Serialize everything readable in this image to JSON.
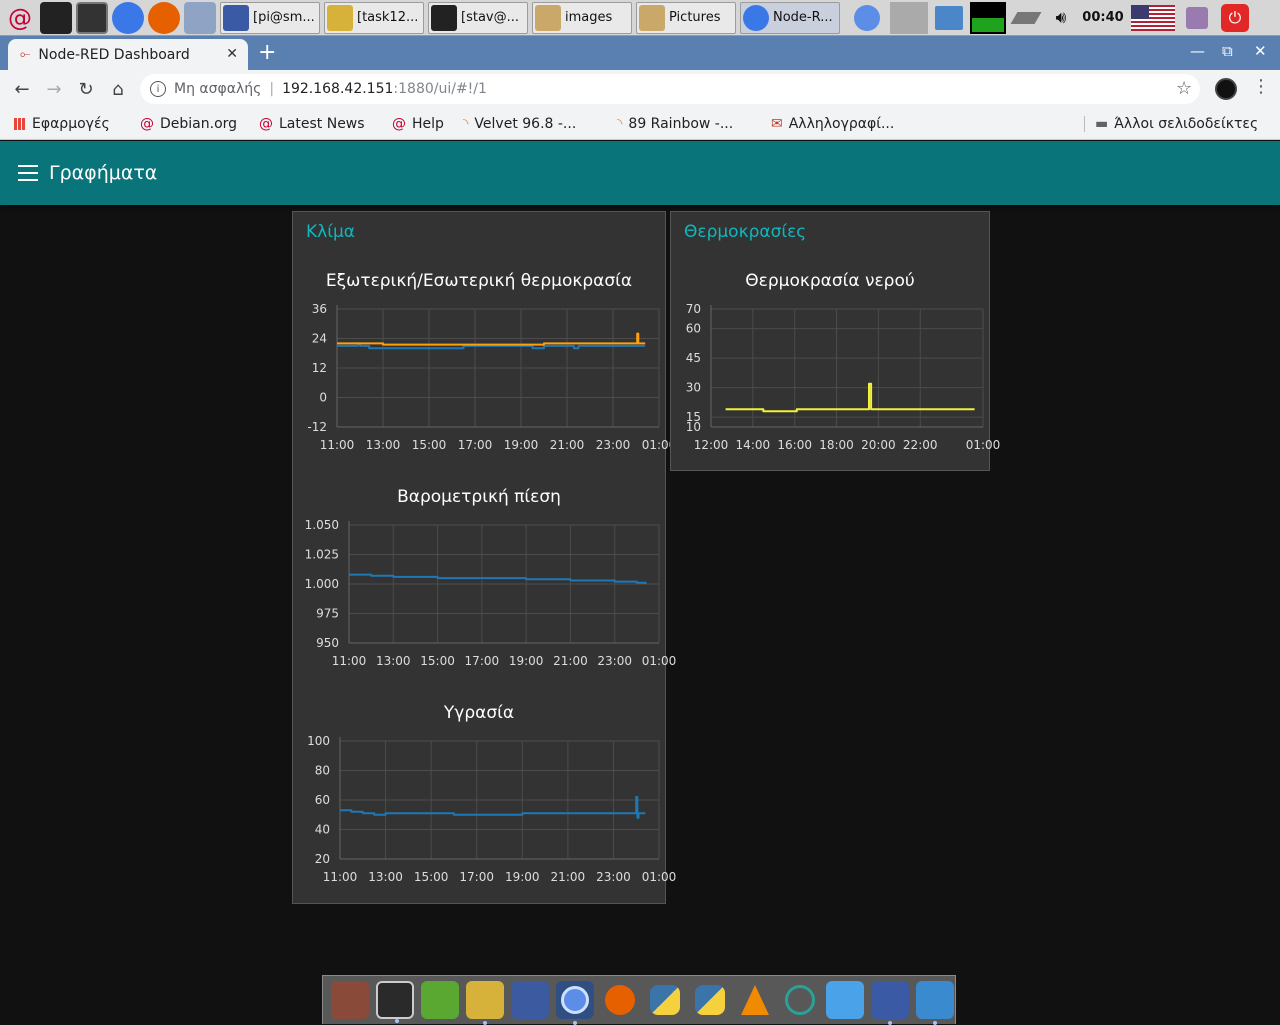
{
  "taskbar": {
    "windows": [
      {
        "label": "[pi@sm...",
        "color": "#3b5aa5"
      },
      {
        "label": "[task12...",
        "color": "#d6b23a"
      },
      {
        "label": "[stav@...",
        "color": "#222222"
      },
      {
        "label": "images",
        "color": "#c9a86a"
      },
      {
        "label": "Pictures",
        "color": "#c9a86a"
      },
      {
        "label": "Node-R...",
        "color": "#3b78e7"
      }
    ],
    "clock": "00:40"
  },
  "browser": {
    "tab_title": "Node-RED Dashboard",
    "new_tab": "+",
    "security_label": "Μη ασφαλής",
    "url_host": "192.168.42.151",
    "url_path": ":1880/ui/#!/1",
    "bookmarks": [
      {
        "label": "Εφαρμογές",
        "icon": "apps-grid-icon"
      },
      {
        "label": "Debian.org",
        "icon": "debian-icon"
      },
      {
        "label": "Latest News",
        "icon": "debian-icon"
      },
      {
        "label": "Help",
        "icon": "debian-icon"
      },
      {
        "label": "Velvet 96.8 -...",
        "icon": "rss-icon"
      },
      {
        "label": "89 Rainbow -...",
        "icon": "rss-icon"
      },
      {
        "label": "Αλληλογραφί...",
        "icon": "mail-icon"
      }
    ],
    "other_bookmarks": "Άλλοι σελιδοδείκτες"
  },
  "dashboard": {
    "page_title": "Γραφήματα",
    "colors": {
      "toolbar": "#097479",
      "group_title": "#0eb8c0",
      "series_blue": "#1f77b4",
      "series_orange": "#ff9f0a",
      "series_yellow": "#f2f23a"
    },
    "groups": [
      {
        "title": "Κλίμα"
      },
      {
        "title": "Θερμοκρασίες"
      }
    ]
  },
  "chart_data": [
    {
      "type": "line",
      "title": "Εξωτερική/Εσωτερική θερμοκρασία",
      "ylim": [
        -12,
        36
      ],
      "yticks": [
        -12,
        0,
        12,
        24,
        36
      ],
      "xlim": [
        11,
        25
      ],
      "xticks": [
        11,
        13,
        15,
        17,
        19,
        21,
        23,
        25
      ],
      "xtick_labels": [
        "11:00",
        "13:00",
        "15:00",
        "17:00",
        "19:00",
        "21:00",
        "23:00",
        "01:00"
      ],
      "series": [
        {
          "color": "#1f77b4",
          "x": [
            11.0,
            11.9,
            12.0,
            12.4,
            13.0,
            14.0,
            15.0,
            16.0,
            16.5,
            17.0,
            18.0,
            19.0,
            19.5,
            20.0,
            21.0,
            21.3,
            21.5,
            22.0,
            23.0,
            23.5,
            24.0,
            24.2,
            24.4
          ],
          "y": [
            21,
            22,
            21,
            20,
            20,
            20,
            20,
            20,
            21,
            21,
            21,
            21,
            20,
            21,
            21,
            20,
            21,
            21,
            21,
            21,
            21,
            21,
            21
          ]
        },
        {
          "color": "#ff9f0a",
          "x": [
            11.0,
            12.0,
            13.0,
            14.0,
            15.0,
            16.0,
            17.0,
            18.0,
            19.0,
            20.0,
            21.0,
            22.0,
            23.0,
            24.0,
            24.05,
            24.1,
            24.2,
            24.4
          ],
          "y": [
            22,
            22,
            21.5,
            21.5,
            21.5,
            21.5,
            21.5,
            21.5,
            21.5,
            22,
            22,
            22,
            22,
            22,
            26,
            22,
            22,
            22
          ]
        }
      ]
    },
    {
      "type": "line",
      "title": "Βαρομετρική πίεση",
      "ylim": [
        950,
        1050
      ],
      "yticks": [
        950,
        975,
        1000,
        1025,
        1050
      ],
      "ytick_labels": [
        "950",
        "975",
        "1.000",
        "1.025",
        "1.050"
      ],
      "xlim": [
        11,
        25
      ],
      "xticks": [
        11,
        13,
        15,
        17,
        19,
        21,
        23,
        25
      ],
      "xtick_labels": [
        "11:00",
        "13:00",
        "15:00",
        "17:00",
        "19:00",
        "21:00",
        "23:00",
        "01:00"
      ],
      "series": [
        {
          "color": "#1f77b4",
          "x": [
            11.0,
            12.0,
            13.0,
            14.0,
            15.0,
            16.0,
            17.0,
            18.0,
            19.0,
            20.0,
            21.0,
            22.0,
            23.0,
            24.0,
            24.4
          ],
          "y": [
            1008,
            1007,
            1006,
            1006,
            1005,
            1005,
            1005,
            1005,
            1004,
            1004,
            1003,
            1003,
            1002,
            1001,
            1000
          ]
        }
      ]
    },
    {
      "type": "line",
      "title": "Υγρασία",
      "ylim": [
        20,
        100
      ],
      "yticks": [
        20,
        40,
        60,
        80,
        100
      ],
      "xlim": [
        11,
        25
      ],
      "xticks": [
        11,
        13,
        15,
        17,
        19,
        21,
        23,
        25
      ],
      "xtick_labels": [
        "11:00",
        "13:00",
        "15:00",
        "17:00",
        "19:00",
        "21:00",
        "23:00",
        "01:00"
      ],
      "series": [
        {
          "color": "#1f77b4",
          "x": [
            11.0,
            11.5,
            12.0,
            12.5,
            13.0,
            14.0,
            15.0,
            16.0,
            17.0,
            18.0,
            19.0,
            20.0,
            21.0,
            22.0,
            23.0,
            23.9,
            24.0,
            24.05,
            24.1,
            24.4
          ],
          "y": [
            53,
            52,
            51,
            50,
            51,
            51,
            51,
            50,
            50,
            50,
            51,
            51,
            51,
            51,
            51,
            51,
            62,
            48,
            51,
            51
          ]
        }
      ]
    },
    {
      "type": "line",
      "title": "Θερμοκρασία νερού",
      "ylim": [
        10,
        70
      ],
      "yticks": [
        10,
        15,
        30,
        45,
        60,
        70
      ],
      "xlim": [
        12,
        25
      ],
      "xticks": [
        12,
        14,
        16,
        18,
        20,
        22,
        25
      ],
      "xtick_labels": [
        "12:00",
        "14:00",
        "16:00",
        "18:00",
        "20:00",
        "22:00",
        "01:00"
      ],
      "series": [
        {
          "color": "#f2f23a",
          "x": [
            12.7,
            14.4,
            14.5,
            16.0,
            16.1,
            19.5,
            19.55,
            19.6,
            19.65,
            24.6
          ],
          "y": [
            19,
            19,
            18,
            18,
            19,
            19,
            32,
            32,
            19,
            19
          ]
        }
      ]
    }
  ]
}
